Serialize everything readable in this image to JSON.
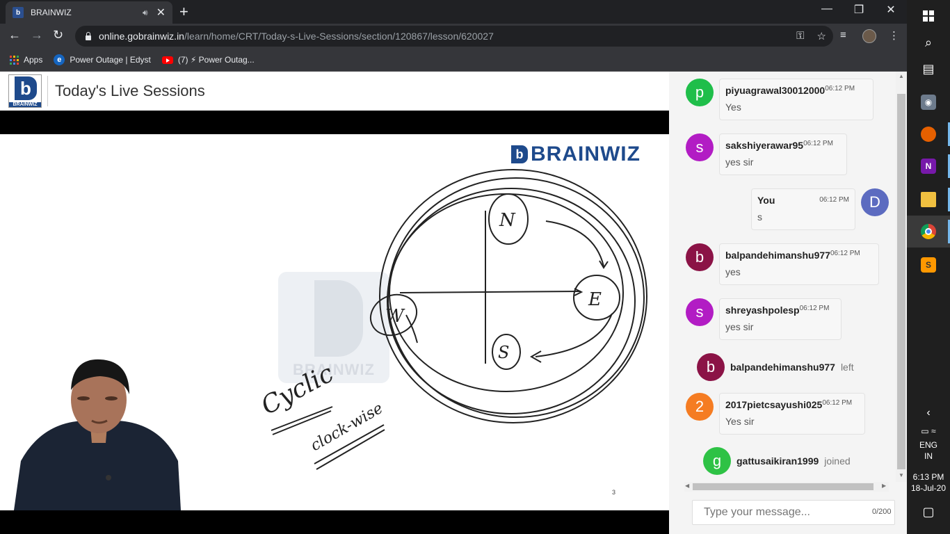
{
  "browser": {
    "tab_title": "BRAINWIZ",
    "tab_favicon": "b",
    "new_tab": "+",
    "url_host": "online.gobrainwiz.in",
    "url_path": "/learn/home/CRT/Today-s-Live-Sessions/section/120867/lesson/620027",
    "bookmarks": [
      {
        "label": "Apps",
        "icon": "apps-grid-icon"
      },
      {
        "label": "Power Outage | Edyst",
        "icon": "edyst-icon"
      },
      {
        "label": "(7) ⚡ Power Outag...",
        "icon": "youtube-icon"
      }
    ]
  },
  "site": {
    "logo_text": "BRAINWIZ",
    "page_title": "Today's Live Sessions"
  },
  "video": {
    "brand": "BRAINWIZ",
    "watermark": "BRAINWIZ",
    "slide_number": "3",
    "handwriting": {
      "n": "N",
      "e": "E",
      "s": "S",
      "w": "W",
      "cyclic": "Cyclic",
      "clockwise": "clock-wise"
    }
  },
  "chat": {
    "messages": [
      {
        "initial": "p",
        "color": "#1fbe4a",
        "user": "piyuagrawal30012000",
        "time": "06:12 PM",
        "text": "Yes"
      },
      {
        "initial": "s",
        "color": "#b21cc4",
        "user": "sakshiyerawar95",
        "time": "06:12 PM",
        "text": "yes sir"
      },
      {
        "initial": "D",
        "color": "#5c6bc0",
        "user": "You",
        "time": "06:12 PM",
        "text": "s"
      },
      {
        "initial": "b",
        "color": "#8b1346",
        "user": "balpandehimanshu977",
        "time": "06:12 PM",
        "text": "yes"
      },
      {
        "initial": "s",
        "color": "#b21cc4",
        "user": "shreyashpolesp",
        "time": "06:12 PM",
        "text": "yes sir"
      },
      {
        "initial": "2",
        "color": "#f57c22",
        "user": "2017pietcsayushi025",
        "time": "06:12 PM",
        "text": "Yes sir"
      }
    ],
    "events": [
      {
        "initial": "b",
        "color": "#8b1346",
        "user": "balpandehimanshu977",
        "action": "left"
      },
      {
        "initial": "g",
        "color": "#2ec245",
        "user": "gattusaikiran1999",
        "action": "joined"
      }
    ],
    "input_placeholder": "Type your message...",
    "char_count": "0/200"
  },
  "taskbar": {
    "language": "ENG",
    "region": "IN",
    "time": "6:13 PM",
    "date": "18-Jul-20"
  }
}
